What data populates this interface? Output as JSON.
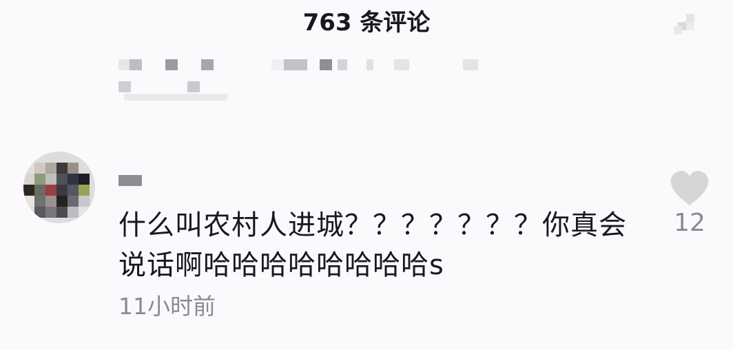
{
  "header": {
    "title": "763 条评论"
  },
  "comment": {
    "text": "什么叫农村人进城？？？？？？？你真会说话啊哈哈哈哈哈哈哈哈s",
    "time": "11小时前",
    "like_count": "12"
  },
  "colors": {
    "text_primary": "#161823",
    "text_secondary": "#8a8b91",
    "like_icon": "#d6d6d9",
    "background": "#fbf9fb"
  },
  "icons": {
    "close": "close-icon",
    "like": "heart-icon"
  }
}
